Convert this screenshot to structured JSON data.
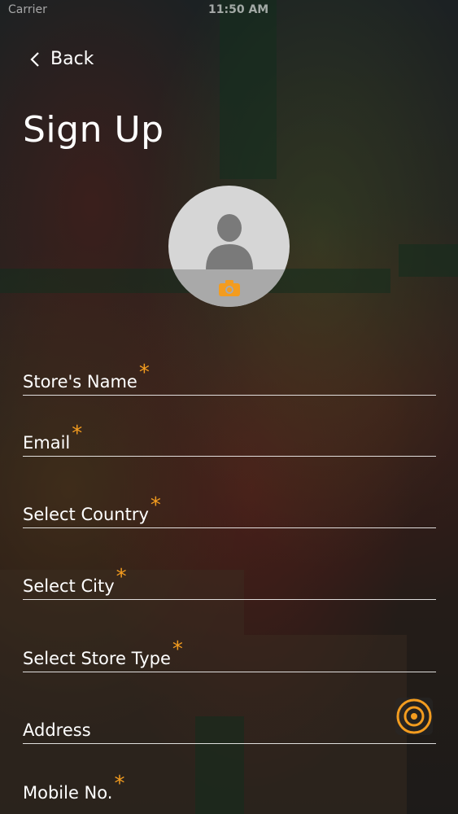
{
  "status_bar": {
    "carrier": "Carrier",
    "time": "11:50 AM"
  },
  "nav": {
    "back_label": "Back"
  },
  "page": {
    "title": "Sign Up"
  },
  "avatar": {
    "icon": "person-icon",
    "camera_icon": "camera-icon"
  },
  "form": {
    "fields": [
      {
        "label": "Store's Name",
        "required": "*"
      },
      {
        "label": "Email",
        "required": "*"
      },
      {
        "label": "Select Country",
        "required": "*"
      },
      {
        "label": "Select City",
        "required": "*"
      },
      {
        "label": "Select Store Type",
        "required": "*"
      },
      {
        "label": "Address",
        "required": ""
      },
      {
        "label": "Mobile No.",
        "required": "*"
      }
    ]
  },
  "colors": {
    "accent": "#f39c1f",
    "text": "#ffffff"
  }
}
